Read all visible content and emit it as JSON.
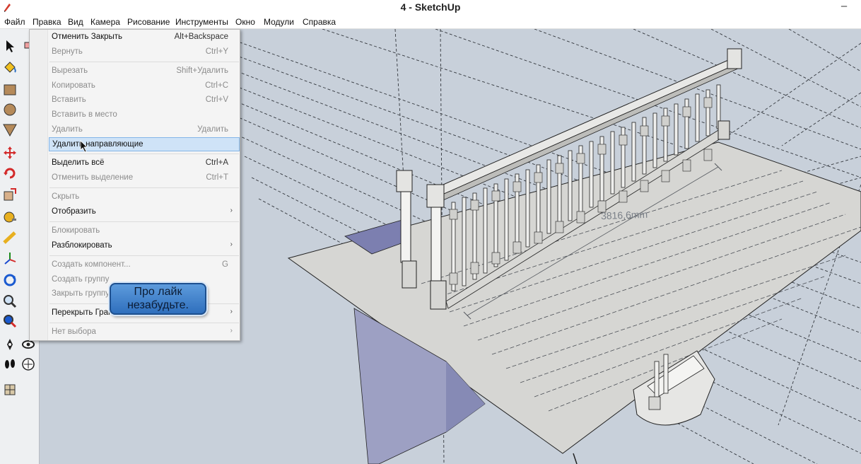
{
  "window": {
    "title": "4 - SketchUp",
    "minimize_symbol": "–"
  },
  "menubar": {
    "items": [
      "Файл",
      "Правка",
      "Вид",
      "Камера",
      "Рисование",
      "Инструменты",
      "Окно",
      "Модули",
      "Справка"
    ]
  },
  "edit_menu": {
    "items": [
      {
        "label": "Отменить Закрыть",
        "shortcut": "Alt+Backspace",
        "enabled": true
      },
      {
        "label": "Вернуть",
        "shortcut": "Ctrl+Y",
        "enabled": false
      },
      {
        "label": "Вырезать",
        "shortcut": "Shift+Удалить",
        "enabled": false
      },
      {
        "label": "Копировать",
        "shortcut": "Ctrl+C",
        "enabled": false
      },
      {
        "label": "Вставить",
        "shortcut": "Ctrl+V",
        "enabled": false
      },
      {
        "label": "Вставить в место",
        "shortcut": "",
        "enabled": false
      },
      {
        "label": "Удалить",
        "shortcut": "Удалить",
        "enabled": false
      },
      {
        "label": "Удалить направляющие",
        "shortcut": "",
        "enabled": true,
        "highlighted": true
      },
      {
        "label": "Выделить всё",
        "shortcut": "Ctrl+A",
        "enabled": true
      },
      {
        "label": "Отменить выделение",
        "shortcut": "Ctrl+T",
        "enabled": false
      },
      {
        "label": "Скрыть",
        "shortcut": "",
        "enabled": false
      },
      {
        "label": "Отобразить",
        "shortcut": "",
        "enabled": true,
        "submenu": true
      },
      {
        "label": "Блокировать",
        "shortcut": "",
        "enabled": false
      },
      {
        "label": "Разблокировать",
        "shortcut": "",
        "enabled": true,
        "submenu": true
      },
      {
        "label": "Создать компонент...",
        "shortcut": "G",
        "enabled": false
      },
      {
        "label": "Создать группу",
        "shortcut": "",
        "enabled": false
      },
      {
        "label": "Закрыть группу",
        "shortcut": "",
        "enabled": false
      },
      {
        "label": "Перекрыть Грани",
        "shortcut": "",
        "enabled": true,
        "submenu": true
      },
      {
        "label": "Нет выбора",
        "shortcut": "",
        "enabled": false,
        "submenu": true
      }
    ],
    "submenu_arrow": "›"
  },
  "overlay": {
    "like_line1": "Про лайк",
    "like_line2": "незабудьте."
  },
  "viewport": {
    "dimension_text": "3816,6mm"
  },
  "toolbar": {
    "tools": [
      "select-icon",
      "paint-bucket-icon",
      "rectangle-icon",
      "circle-icon",
      "polygon-icon",
      "move-icon",
      "rotate-icon",
      "scale-icon",
      "tape-measure-icon",
      "protractor-icon",
      "axes-icon",
      "orbit-icon",
      "zoom-icon",
      "zoom-extents-icon",
      "position-camera-icon",
      "walk-icon",
      "sandbox-icon"
    ]
  },
  "colors": {
    "menu_highlight": "#cfe3f7",
    "viewport_bg": "#c8d0da",
    "bubble_blue": "#3f7fcc"
  }
}
